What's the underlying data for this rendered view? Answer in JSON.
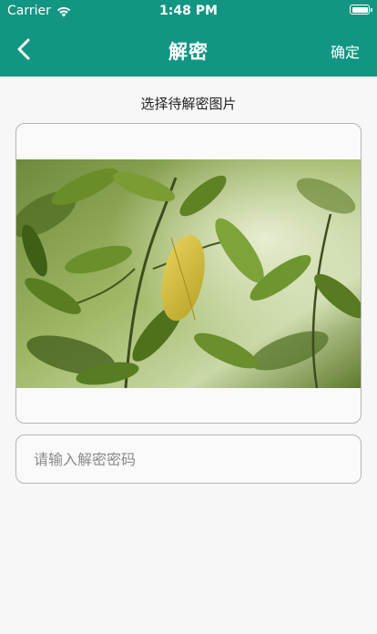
{
  "status_bar": {
    "carrier": "Carrier",
    "time": "1:48 PM",
    "wifi_icon": "wifi-icon",
    "battery_icon": "battery-icon"
  },
  "nav": {
    "back_icon": "chevron-left-icon",
    "title": "解密",
    "confirm_label": "确定"
  },
  "main": {
    "image_section_label": "选择待解密图片",
    "image_description": "photo of green citrus leaves with one yellowing leaf",
    "password_placeholder": "请输入解密密码",
    "password_value": ""
  },
  "colors": {
    "header_bg": "#139583",
    "header_text": "#ffffff",
    "page_bg": "#f7f7f7",
    "field_border": "#b5b5b5",
    "placeholder_text": "#8a8a8a"
  }
}
